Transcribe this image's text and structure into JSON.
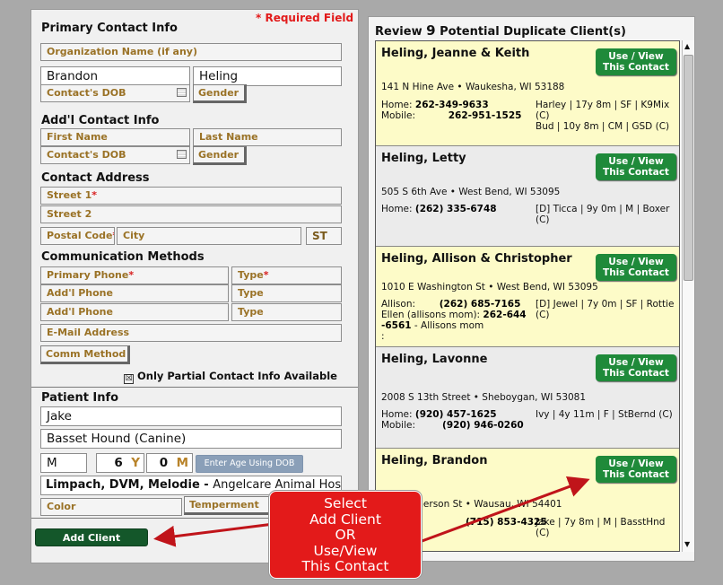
{
  "form": {
    "required_note": "* Required Field",
    "primary_title": "Primary Contact Info",
    "org_name": "Organization Name   (if any)",
    "first_value": "Brandon",
    "last_value": "Heling",
    "dob_label": "Contact's DOB",
    "gender_label": "Gender",
    "addl_title": "Add'l Contact Info",
    "first_name_label": "First Name",
    "last_name_label": "Last Name",
    "addl_dob_label": "Contact's DOB",
    "addl_gender_label": "Gender",
    "address_title": "Contact Address",
    "street1_label": "Street 1",
    "street2_label": "Street 2",
    "postal_label": "Postal Code",
    "city_label": "City",
    "state_label": "ST",
    "comm_title": "Communication Methods",
    "primary_phone_label": "Primary Phone",
    "type_label": "Type",
    "addl_phone_label": "Add'l Phone",
    "type2_label": "Type",
    "addl_phone2_label": "Add'l Phone",
    "type3_label": "Type",
    "email_label": "E-Mail Address",
    "comm_method_label": "Comm Method",
    "partial_checkbox": "Only Partial Contact Info Available",
    "partial_mark": "☒",
    "patient_title": "Patient Info",
    "patient_name": "Jake",
    "breed": "Basset Hound (Canine)",
    "sex": "M",
    "years": "6",
    "years_unit": "Y",
    "months": "0",
    "months_unit": "M",
    "dob_button": "Enter Age Using DOB",
    "vet_name": "Limpach, DVM, Melodie - ",
    "vet_hospital": "Angelcare Animal Hospital",
    "color_label": "Color",
    "temperament_label": "Temperment",
    "add_client_label": "Add Client"
  },
  "review": {
    "title_prefix": "Review ",
    "count": "9",
    "title_suffix": " Potential Duplicate Client(s)",
    "use_view": "Use / View",
    "this_contact": "This Contact",
    "clients": [
      {
        "name": "Heling, Jeanne & Keith",
        "address": "141 N Hine Ave • Waukesha, WI  53188",
        "home_label": "Home:",
        "home": "262-349-9633",
        "mobile_label": "Mobile:",
        "mobile": "262-951-1525",
        "pets": "Harley | 17y 8m | SF | K9Mix (C)",
        "pets2": "Bud | 10y 8m | CM | GSD (C)"
      },
      {
        "name": "Heling, Letty",
        "address": "505 S 6th Ave • West Bend, WI  53095",
        "home_label": "Home:",
        "home": "(262) 335-6748",
        "pets": "[D] Ticca | 9y 0m | M | Boxer (C)"
      },
      {
        "name": "Heling, Allison & Christopher",
        "address": "1010 E Washington St • West Bend, WI  53095",
        "home_label": "Allison:",
        "home": "(262) 685-7165",
        "line2_label": "Ellen (allisons mom):",
        "line2": "262-644",
        "line3": "-6561",
        "line3_note": "  -  Allisons mom",
        "line4": ":",
        "pets": "[D] Jewel | 7y 0m | SF | Rottie (C)"
      },
      {
        "name": "Heling, Lavonne",
        "address": "2008 S 13th Street • Sheboygan, WI  53081",
        "home_label": "Home:",
        "home": "(920) 457-1625",
        "mobile_label": "Mobile:",
        "mobile": "(920) 946-0260",
        "pets": "Ivy | 4y 11m | F | StBernd (C)"
      },
      {
        "name": "Heling, Brandon",
        "address": "2402 Emerson St • Wausau, WI  54401",
        "home": "(715) 853-4325",
        "pets": "Jake | 7y 8m | M | BasstHnd (C)"
      }
    ]
  },
  "callout": {
    "line1": "Select",
    "line2": "Add Client",
    "line3": "OR",
    "line4": "Use/View",
    "line5": "This Contact"
  },
  "colors": {
    "accent_green": "#1f8a3a",
    "dark_green": "#14572a",
    "required_red": "#e21a1a",
    "label_gold": "#9a7226",
    "callout_red": "#e31a1a"
  }
}
